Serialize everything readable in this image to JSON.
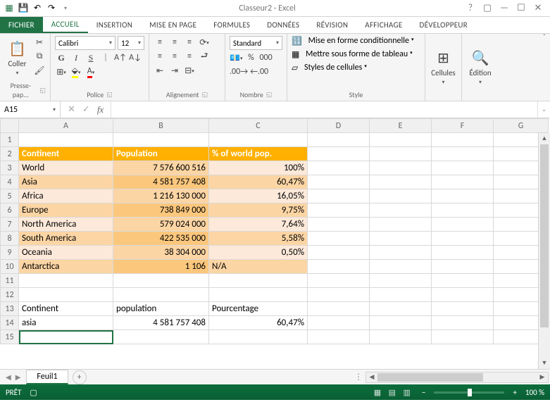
{
  "window": {
    "title": "Classeur2 - Excel"
  },
  "tabs": {
    "file": "FICHIER",
    "home": "ACCUEIL",
    "insert": "INSERTION",
    "layout": "MISE EN PAGE",
    "formulas": "FORMULES",
    "data": "DONNÉES",
    "review": "RÉVISION",
    "view": "AFFICHAGE",
    "developer": "DÉVELOPPEUR"
  },
  "ribbon": {
    "clipboard": {
      "paste": "Coller",
      "label": "Presse-pap..."
    },
    "font": {
      "name": "Calibri",
      "size": "12",
      "bold": "G",
      "italic": "I",
      "underline": "S",
      "label": "Police"
    },
    "align": {
      "label": "Alignement"
    },
    "number": {
      "format": "Standard",
      "label": "Nombre"
    },
    "styles": {
      "cond": "Mise en forme conditionnelle",
      "table": "Mettre sous forme de tableau",
      "cell": "Styles de cellules",
      "label": "Style"
    },
    "cells": {
      "label": "Cellules"
    },
    "editing": {
      "label": "Édition"
    }
  },
  "namebox": "A15",
  "columns": [
    "A",
    "B",
    "C",
    "D",
    "E",
    "F",
    "G"
  ],
  "rows": [
    {
      "n": "1",
      "a": "",
      "b": "",
      "c": ""
    },
    {
      "n": "2",
      "a": "Continent",
      "b": "Population",
      "c": "% of world pop.",
      "hdr": true
    },
    {
      "n": "3",
      "a": "World",
      "b": "7 576 600 516",
      "c": "100%",
      "alt": false
    },
    {
      "n": "4",
      "a": "Asia",
      "b": "4 581 757 408",
      "c": "60,47%",
      "alt": true
    },
    {
      "n": "5",
      "a": "Africa",
      "b": "1 216 130 000",
      "c": "16,05%",
      "alt": false
    },
    {
      "n": "6",
      "a": "Europe",
      "b": "738 849 000",
      "c": "9,75%",
      "alt": true
    },
    {
      "n": "7",
      "a": "North America",
      "b": "579 024 000",
      "c": "7,64%",
      "alt": false
    },
    {
      "n": "8",
      "a": "South America",
      "b": "422 535 000",
      "c": "5,58%",
      "alt": true
    },
    {
      "n": "9",
      "a": "Oceania",
      "b": "38 304 000",
      "c": "0,50%",
      "alt": false
    },
    {
      "n": "10",
      "a": "Antarctica",
      "b": "1 106",
      "c": "N/A",
      "alt": true,
      "cLeft": true
    },
    {
      "n": "11",
      "a": "",
      "b": "",
      "c": ""
    },
    {
      "n": "12",
      "a": "",
      "b": "",
      "c": ""
    },
    {
      "n": "13",
      "a": "Continent",
      "b": "population",
      "c": "Pourcentage",
      "plain": true,
      "bLeft": true,
      "cLeft": true
    },
    {
      "n": "14",
      "a": "asia",
      "b": "4 581 757 408",
      "c": "60,47%",
      "plain": true
    },
    {
      "n": "15",
      "a": "",
      "b": "",
      "c": "",
      "sel": true
    }
  ],
  "sheet": {
    "name": "Feuil1"
  },
  "status": {
    "ready": "PRÊT",
    "zoom": "100 %"
  }
}
